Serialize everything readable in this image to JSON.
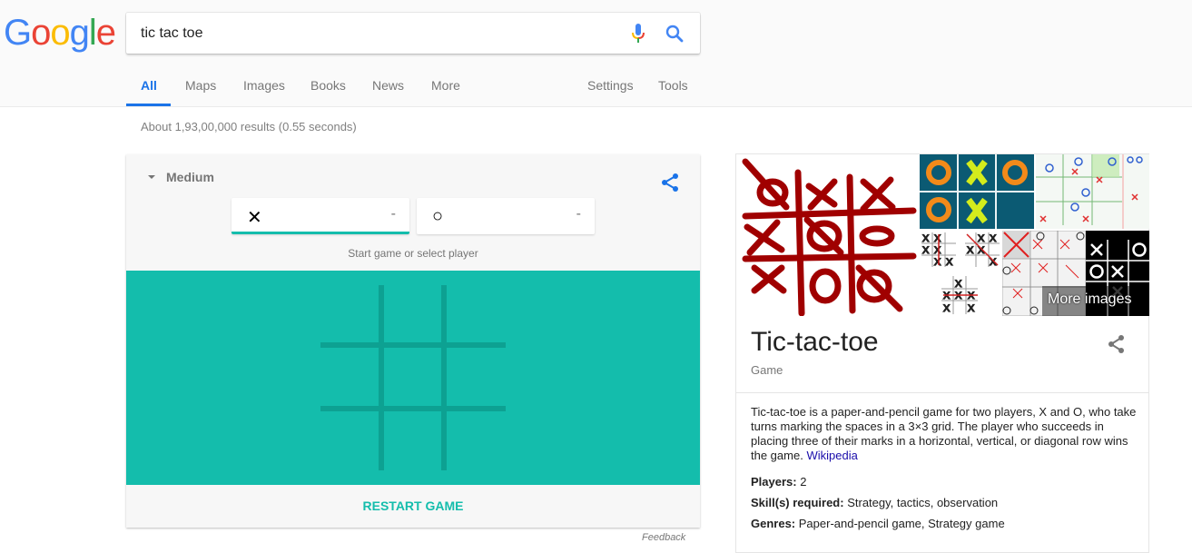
{
  "logo": {
    "letters": [
      "G",
      "o",
      "o",
      "g",
      "l",
      "e"
    ],
    "colors": [
      "#4285f4",
      "#ea4335",
      "#fbbc05",
      "#4285f4",
      "#34a853",
      "#ea4335"
    ]
  },
  "search": {
    "query": "tic tac toe",
    "mic_icon": "microphone-icon",
    "search_icon": "search-icon"
  },
  "tabs": [
    {
      "label": "All",
      "active": true
    },
    {
      "label": "Maps"
    },
    {
      "label": "Images"
    },
    {
      "label": "Books"
    },
    {
      "label": "News"
    },
    {
      "label": "More"
    },
    {
      "label": "Settings"
    },
    {
      "label": "Tools"
    }
  ],
  "result_stats": "About 1,93,00,000 results (0.55 seconds)",
  "game": {
    "difficulty": "Medium",
    "players": [
      {
        "mark": "✕",
        "score": "-",
        "active": true
      },
      {
        "mark": "○",
        "score": "-",
        "active": false
      }
    ],
    "hint": "Start game or select player",
    "restart_label": "RESTART GAME",
    "feedback_label": "Feedback",
    "colors": {
      "board": "#14bdac",
      "grid": "#0da192",
      "share": "#1a73e8"
    }
  },
  "knowledge_panel": {
    "more_images_label": "More images",
    "title": "Tic-tac-toe",
    "subtitle": "Game",
    "description": "Tic-tac-toe is a paper-and-pencil game for two players, X and O, who take turns marking the spaces in a 3×3 grid. The player who succeeds in placing three of their marks in a horizontal, vertical, or diagonal row wins the game.",
    "source_link": "Wikipedia",
    "facts": [
      {
        "label": "Players:",
        "value": "2"
      },
      {
        "label": "Skill(s) required:",
        "value": "Strategy, tactics, observation"
      },
      {
        "label": "Genres:",
        "value": "Paper-and-pencil game, Strategy game"
      }
    ]
  }
}
